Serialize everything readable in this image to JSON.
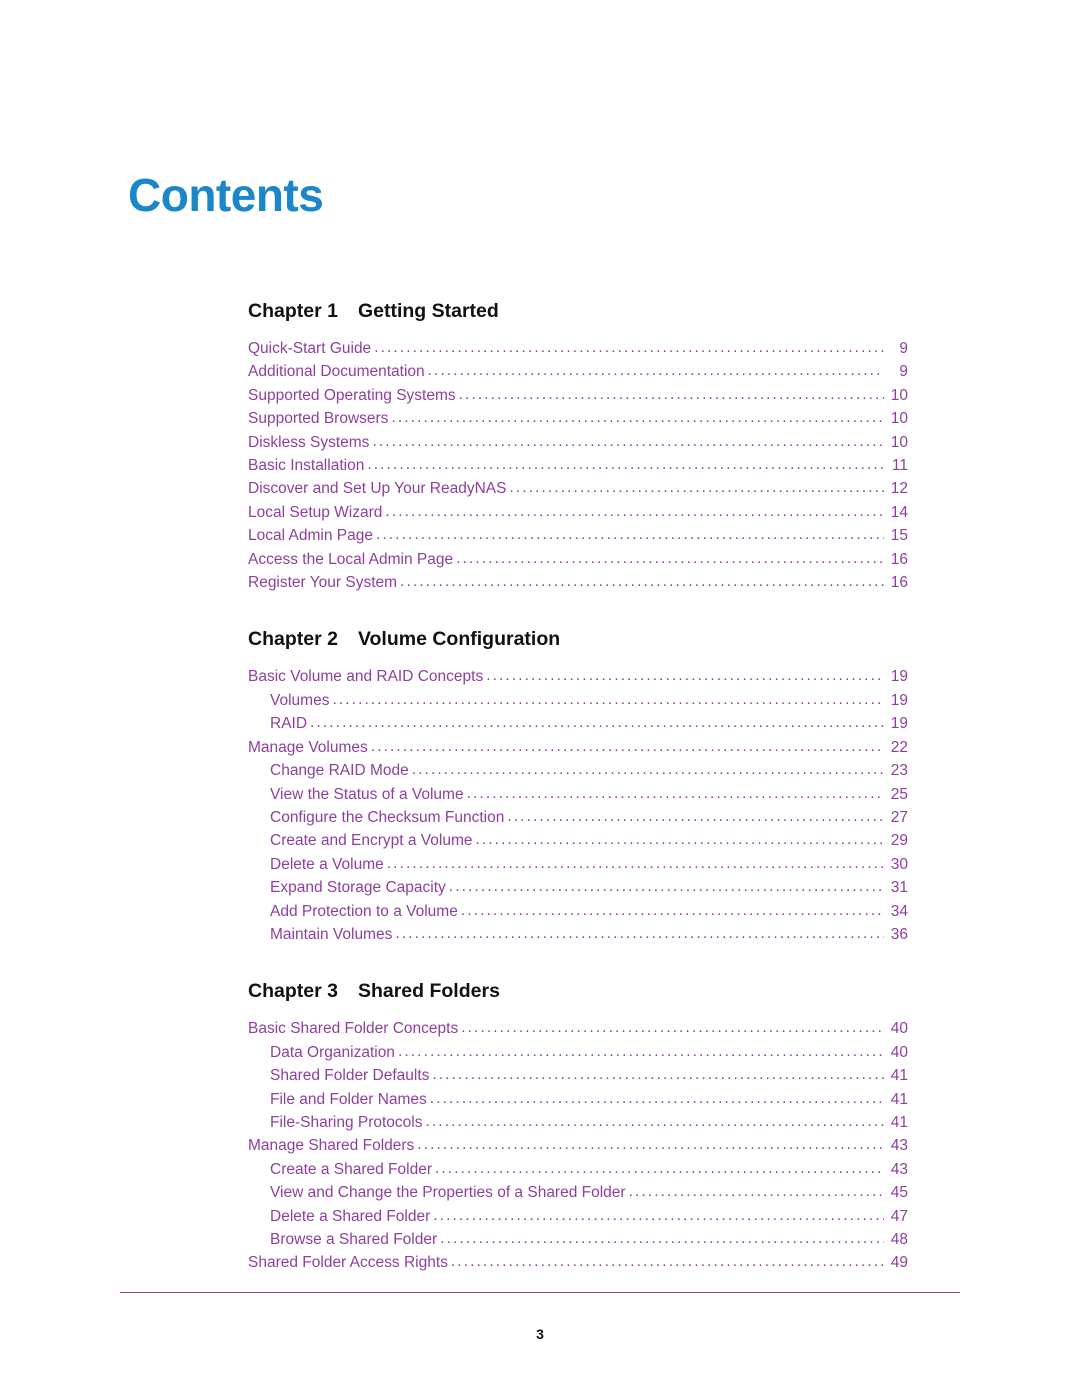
{
  "page": {
    "title": "Contents",
    "footer_page_number": "3"
  },
  "chapters": [
    {
      "label": "Chapter 1",
      "title": "Getting Started",
      "entries": [
        {
          "level": 1,
          "label": "Quick-Start Guide",
          "page": "9"
        },
        {
          "level": 1,
          "label": "Additional Documentation",
          "page": "9"
        },
        {
          "level": 1,
          "label": "Supported Operating Systems",
          "page": "10"
        },
        {
          "level": 1,
          "label": "Supported Browsers",
          "page": "10"
        },
        {
          "level": 1,
          "label": "Diskless Systems",
          "page": "10"
        },
        {
          "level": 1,
          "label": "Basic Installation",
          "page": "11"
        },
        {
          "level": 1,
          "label": "Discover and Set Up Your ReadyNAS",
          "page": "12"
        },
        {
          "level": 1,
          "label": "Local Setup Wizard",
          "page": "14"
        },
        {
          "level": 1,
          "label": "Local Admin Page",
          "page": "15"
        },
        {
          "level": 1,
          "label": "Access the Local Admin Page",
          "page": "16"
        },
        {
          "level": 1,
          "label": "Register Your System",
          "page": "16"
        }
      ]
    },
    {
      "label": "Chapter 2",
      "title": "Volume Configuration",
      "entries": [
        {
          "level": 1,
          "label": "Basic Volume and RAID Concepts",
          "page": "19"
        },
        {
          "level": 2,
          "label": "Volumes",
          "page": "19"
        },
        {
          "level": 2,
          "label": "RAID",
          "page": "19"
        },
        {
          "level": 1,
          "label": "Manage Volumes",
          "page": "22"
        },
        {
          "level": 2,
          "label": "Change RAID Mode",
          "page": "23"
        },
        {
          "level": 2,
          "label": "View the Status of a Volume",
          "page": "25"
        },
        {
          "level": 2,
          "label": "Configure the Checksum Function",
          "page": "27"
        },
        {
          "level": 2,
          "label": "Create and Encrypt a Volume",
          "page": "29"
        },
        {
          "level": 2,
          "label": "Delete a Volume",
          "page": "30"
        },
        {
          "level": 2,
          "label": "Expand Storage Capacity",
          "page": "31"
        },
        {
          "level": 2,
          "label": "Add Protection to a Volume",
          "page": "34"
        },
        {
          "level": 2,
          "label": "Maintain Volumes",
          "page": "36"
        }
      ]
    },
    {
      "label": "Chapter 3",
      "title": "Shared Folders",
      "entries": [
        {
          "level": 1,
          "label": "Basic Shared Folder Concepts",
          "page": "40"
        },
        {
          "level": 2,
          "label": "Data Organization",
          "page": "40"
        },
        {
          "level": 2,
          "label": "Shared Folder Defaults",
          "page": "41"
        },
        {
          "level": 2,
          "label": "File and Folder Names",
          "page": "41"
        },
        {
          "level": 2,
          "label": "File-Sharing Protocols",
          "page": "41"
        },
        {
          "level": 1,
          "label": "Manage Shared Folders",
          "page": "43"
        },
        {
          "level": 2,
          "label": "Create a Shared Folder",
          "page": "43"
        },
        {
          "level": 2,
          "label": "View and Change the Properties of a Shared Folder",
          "page": "45"
        },
        {
          "level": 2,
          "label": "Delete a Shared Folder",
          "page": "47"
        },
        {
          "level": 2,
          "label": "Browse a Shared Folder",
          "page": "48"
        },
        {
          "level": 1,
          "label": "Shared Folder Access Rights",
          "page": "49"
        }
      ]
    }
  ]
}
